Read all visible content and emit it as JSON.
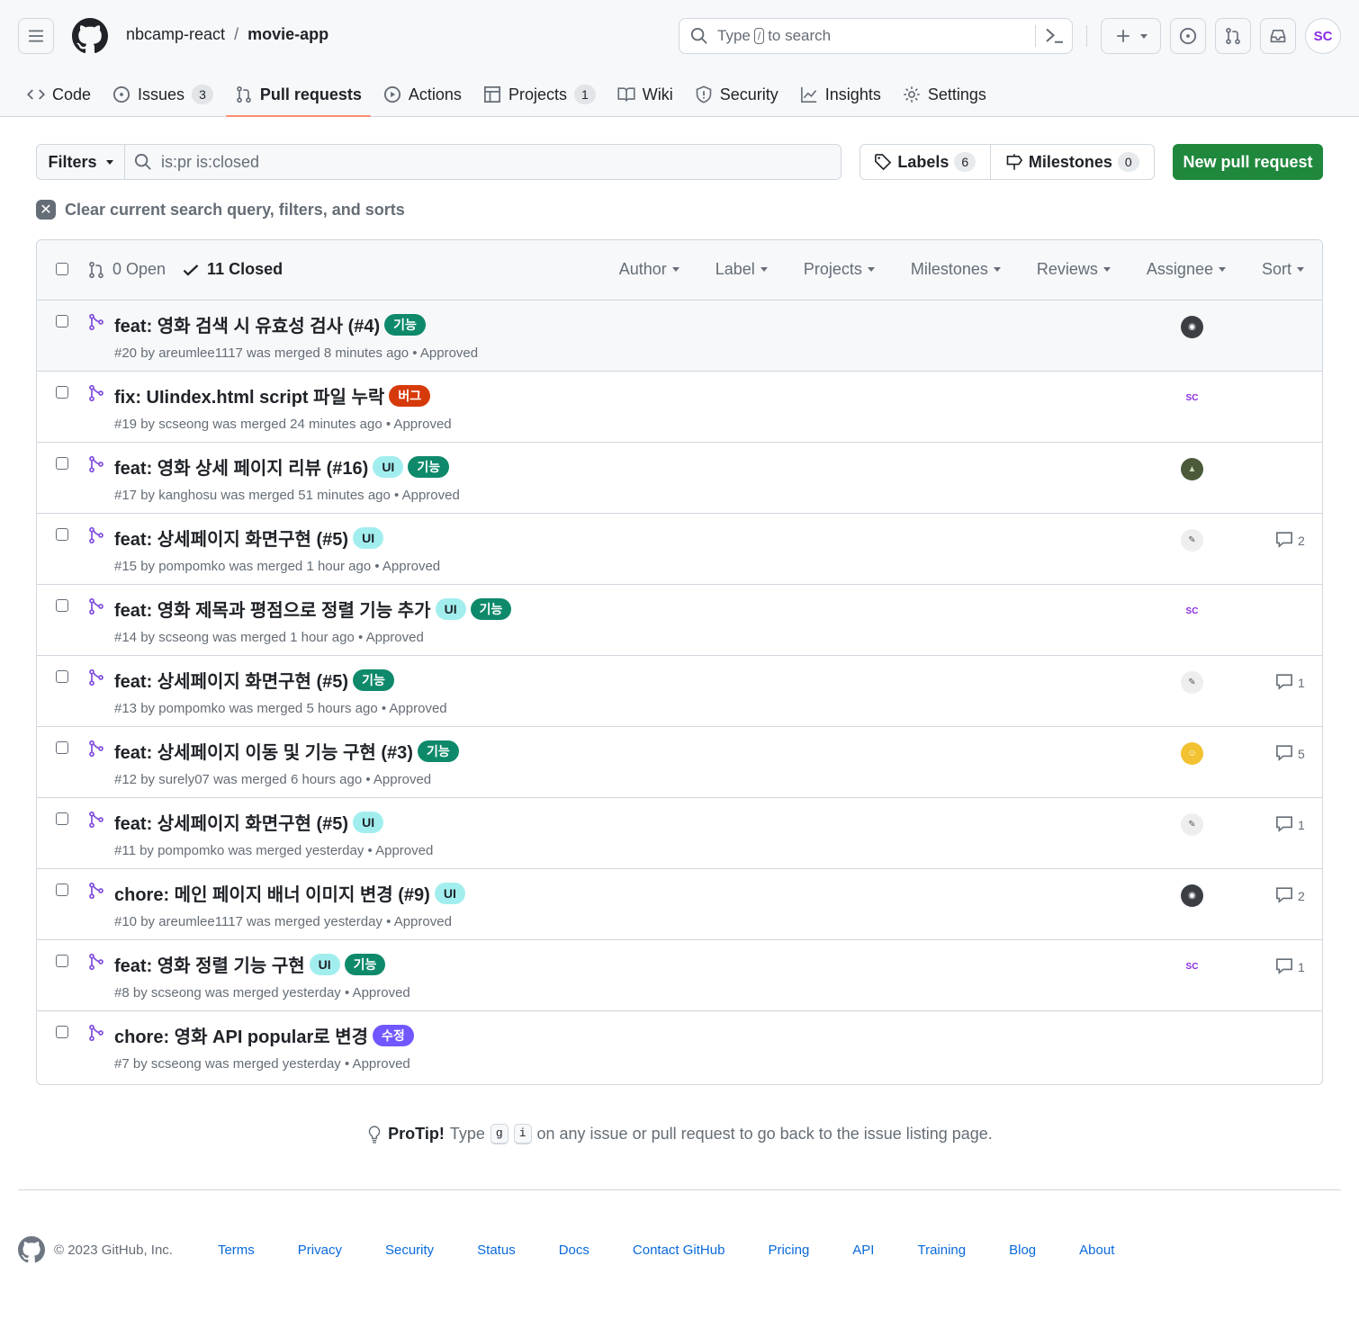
{
  "header": {
    "owner": "nbcamp-react",
    "separator": "/",
    "repo": "movie-app",
    "search_type": "Type",
    "search_key": "/",
    "search_rest": "to search",
    "user_avatar": "SC"
  },
  "nav": [
    {
      "icon": "code-icon",
      "label": "Code",
      "count": ""
    },
    {
      "icon": "issue-icon",
      "label": "Issues",
      "count": "3"
    },
    {
      "icon": "pull-request-icon",
      "label": "Pull requests",
      "count": ""
    },
    {
      "icon": "play-icon",
      "label": "Actions",
      "count": ""
    },
    {
      "icon": "table-icon",
      "label": "Projects",
      "count": "1"
    },
    {
      "icon": "book-icon",
      "label": "Wiki",
      "count": ""
    },
    {
      "icon": "shield-icon",
      "label": "Security",
      "count": ""
    },
    {
      "icon": "graph-icon",
      "label": "Insights",
      "count": ""
    },
    {
      "icon": "gear-icon",
      "label": "Settings",
      "count": ""
    }
  ],
  "toolbar": {
    "filters_label": "Filters",
    "query": "is:pr is:closed",
    "labels_label": "Labels",
    "labels_count": "6",
    "milestones_label": "Milestones",
    "milestones_count": "0",
    "new_pr_label": "New pull request",
    "clear_label": "Clear current search query, filters, and sorts"
  },
  "list_header": {
    "open_label": "0 Open",
    "closed_label": "11 Closed",
    "filters": [
      "Author",
      "Label",
      "Projects",
      "Milestones",
      "Reviews",
      "Assignee",
      "Sort"
    ]
  },
  "pulls": [
    {
      "title": "feat: 영화 검색 시 유효성 검사 (#4)",
      "labels": [
        {
          "text": "기능",
          "bg": "#0e8a6b",
          "fg": "#ffffff"
        }
      ],
      "meta": "#20 by areumlee1117 was merged 8 minutes ago • Approved",
      "assignee": "dark",
      "comments": ""
    },
    {
      "title": "fix: UIindex.html script 파일 누락",
      "labels": [
        {
          "text": "버그",
          "bg": "#d73a0a",
          "fg": "#ffffff"
        }
      ],
      "meta": "#19 by scseong was merged 24 minutes ago • Approved",
      "assignee": "sc",
      "comments": ""
    },
    {
      "title": "feat: 영화 상세 페이지 리뷰 (#16)",
      "labels": [
        {
          "text": "UI",
          "bg": "#a2eeef",
          "fg": "#1f2328"
        },
        {
          "text": "기능",
          "bg": "#0e8a6b",
          "fg": "#ffffff"
        }
      ],
      "meta": "#17 by kanghosu was merged 51 minutes ago • Approved",
      "assignee": "photo",
      "comments": ""
    },
    {
      "title": "feat: 상세페이지 화면구현 (#5)",
      "labels": [
        {
          "text": "UI",
          "bg": "#a2eeef",
          "fg": "#1f2328"
        }
      ],
      "meta": "#15 by pompomko was merged 1 hour ago • Approved",
      "assignee": "sketch",
      "comments": "2"
    },
    {
      "title": "feat: 영화 제목과 평점으로 정렬 기능 추가",
      "labels": [
        {
          "text": "UI",
          "bg": "#a2eeef",
          "fg": "#1f2328"
        },
        {
          "text": "기능",
          "bg": "#0e8a6b",
          "fg": "#ffffff"
        }
      ],
      "meta": "#14 by scseong was merged 1 hour ago • Approved",
      "assignee": "sc",
      "comments": ""
    },
    {
      "title": "feat: 상세페이지 화면구현 (#5)",
      "labels": [
        {
          "text": "기능",
          "bg": "#0e8a6b",
          "fg": "#ffffff"
        }
      ],
      "meta": "#13 by pompomko was merged 5 hours ago • Approved",
      "assignee": "sketch",
      "comments": "1"
    },
    {
      "title": "feat: 상세페이지 이동 및 기능 구현 (#3)",
      "labels": [
        {
          "text": "기능",
          "bg": "#0e8a6b",
          "fg": "#ffffff"
        }
      ],
      "meta": "#12 by surely07 was merged 6 hours ago • Approved",
      "assignee": "yellow",
      "comments": "5"
    },
    {
      "title": "feat: 상세페이지 화면구현 (#5)",
      "labels": [
        {
          "text": "UI",
          "bg": "#a2eeef",
          "fg": "#1f2328"
        }
      ],
      "meta": "#11 by pompomko was merged yesterday • Approved",
      "assignee": "sketch",
      "comments": "1"
    },
    {
      "title": "chore: 메인 페이지 배너 이미지 변경 (#9)",
      "labels": [
        {
          "text": "UI",
          "bg": "#a2eeef",
          "fg": "#1f2328"
        }
      ],
      "meta": "#10 by areumlee1117 was merged yesterday • Approved",
      "assignee": "dark",
      "comments": "2"
    },
    {
      "title": "feat: 영화 정렬 기능 구현",
      "labels": [
        {
          "text": "UI",
          "bg": "#a2eeef",
          "fg": "#1f2328"
        },
        {
          "text": "기능",
          "bg": "#0e8a6b",
          "fg": "#ffffff"
        }
      ],
      "meta": "#8 by scseong was merged yesterday • Approved",
      "assignee": "sc",
      "comments": "1"
    },
    {
      "title": "chore: 영화 API popular로 변경",
      "labels": [
        {
          "text": "수정",
          "bg": "#7057ff",
          "fg": "#ffffff"
        }
      ],
      "meta": "#7 by scseong was merged yesterday • Approved",
      "assignee": "",
      "comments": ""
    }
  ],
  "protip": {
    "strong": "ProTip!",
    "pre": "Type",
    "key1": "g",
    "key2": "i",
    "post": "on any issue or pull request to go back to the issue listing page."
  },
  "footer": {
    "copyright": "© 2023 GitHub, Inc.",
    "links": [
      "Terms",
      "Privacy",
      "Security",
      "Status",
      "Docs",
      "Contact GitHub",
      "Pricing",
      "API",
      "Training",
      "Blog",
      "About"
    ]
  },
  "colors": {
    "accent": "#1f883d",
    "merged": "#8250df",
    "link": "#0969da",
    "nav_underline": "#fd8c73"
  }
}
